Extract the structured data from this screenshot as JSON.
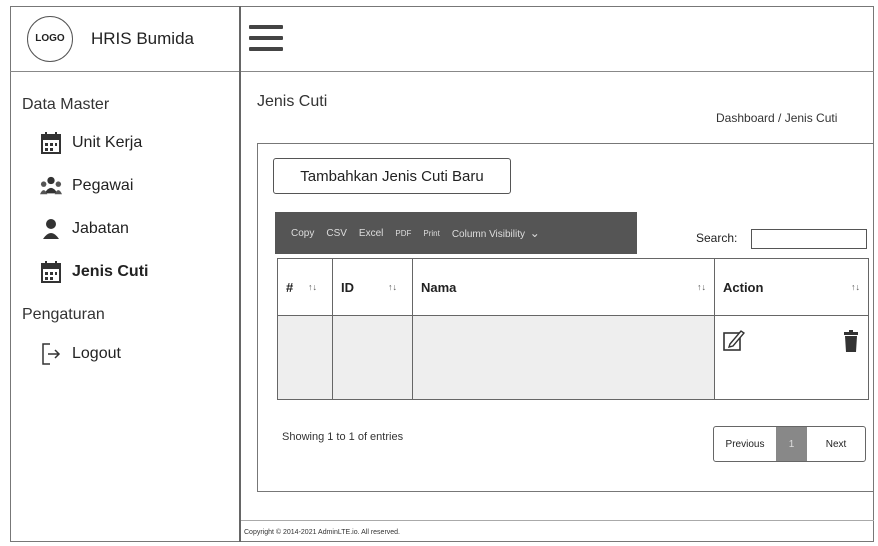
{
  "brand": {
    "logo_text": "LOGO",
    "name": "HRIS Bumida"
  },
  "sidebar": {
    "section_master": "Data Master",
    "items": [
      {
        "label": "Unit Kerja",
        "icon": "calendar-icon"
      },
      {
        "label": "Pegawai",
        "icon": "users-icon"
      },
      {
        "label": "Jabatan",
        "icon": "user-icon"
      },
      {
        "label": "Jenis Cuti",
        "icon": "calendar-icon",
        "active": true
      }
    ],
    "section_settings": "Pengaturan",
    "logout_label": "Logout"
  },
  "header": {
    "menu_icon": "hamburger-icon"
  },
  "page": {
    "title": "Jenis Cuti",
    "breadcrumb": "Dashboard / Jenis Cuti",
    "add_button": "Tambahkan Jenis Cuti Baru"
  },
  "toolbar": {
    "copy": "Copy",
    "csv": "CSV",
    "excel": "Excel",
    "pdf": "PDF",
    "print": "Print",
    "colvis": "Column Visibility"
  },
  "search": {
    "label": "Search:",
    "value": ""
  },
  "table": {
    "headers": [
      "#",
      "ID",
      "Nama",
      "Action"
    ],
    "sort_glyph": "↑↓"
  },
  "pagination": {
    "info": "Showing 1 to 1 of entries",
    "previous": "Previous",
    "current": "1",
    "next": "Next"
  },
  "footer": {
    "text": "Copyright © 2014-2021 AdminLTE.io. All reserved."
  },
  "colors": {
    "toolbar_bg": "#555555",
    "row_bg": "#eeeeee",
    "page_active": "#888888"
  }
}
